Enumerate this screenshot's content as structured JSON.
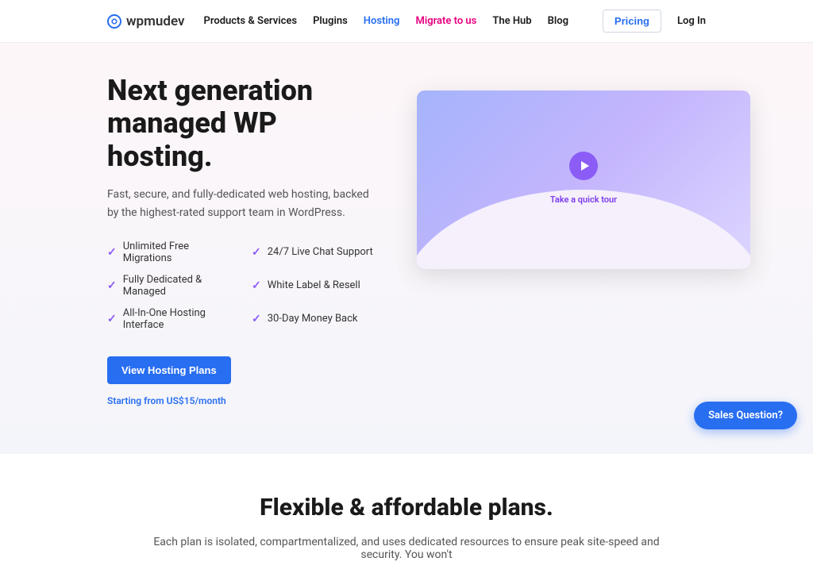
{
  "brand": "wpmudev",
  "nav": {
    "items": [
      {
        "label": "Products & Services"
      },
      {
        "label": "Plugins"
      },
      {
        "label": "Hosting"
      },
      {
        "label": "Migrate to us"
      },
      {
        "label": "The Hub"
      },
      {
        "label": "Blog"
      }
    ],
    "pricing": "Pricing",
    "login": "Log In"
  },
  "hero": {
    "title": "Next generation managed WP hosting.",
    "subtitle": "Fast, secure, and fully-dedicated web hosting, backed by the highest-rated support team in WordPress.",
    "features": [
      "Unlimited Free Migrations",
      "24/7 Live Chat Support",
      "Fully Dedicated & Managed",
      "White Label & Resell",
      "All-In-One Hosting Interface",
      "30-Day Money Back"
    ],
    "cta": "View Hosting Plans",
    "starting": "Starting from US$15/month",
    "tour": "Take a quick tour"
  },
  "plans": {
    "title": "Flexible & affordable plans.",
    "subtitle": "Each plan is isolated, compartmentalized, and uses dedicated resources to ensure peak site-speed and security. You won't"
  },
  "sales_badge": "Sales Question?"
}
